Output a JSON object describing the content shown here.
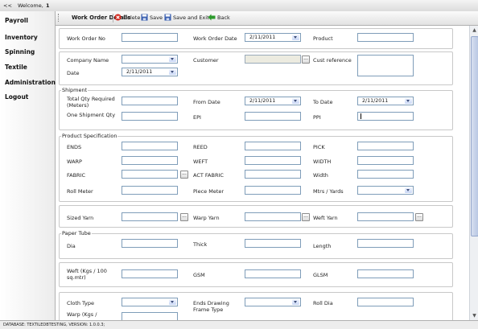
{
  "topbar": {
    "nav": "<<",
    "welcome": "Welcome,",
    "user": "1"
  },
  "sidebar": {
    "items": [
      {
        "label": "Payroll"
      },
      {
        "label": "Inventory"
      },
      {
        "label": "Spinning"
      },
      {
        "label": "Textile"
      },
      {
        "label": "Administration"
      },
      {
        "label": "Logout"
      }
    ]
  },
  "toolbar": {
    "title": "Work Order Details",
    "delete_label": "Delete",
    "save_label": "Save",
    "save_exit_label": "Save and Exit",
    "back_label": "Back",
    "icons": {
      "delete": "delete-icon",
      "save": "save-icon",
      "save_exit": "save-exit-icon",
      "back": "back-arrow-icon"
    },
    "colors": {
      "delete": "#d2281e",
      "save": "#3a5fb0",
      "back": "#2c9a2c"
    }
  },
  "form": {
    "work_order_no_label": "Work Order No",
    "work_order_date_label": "Work Order Date",
    "work_order_date_value": "2/11/2011",
    "product_label": "Product",
    "company_name_label": "Company Name",
    "customer_label": "Customer",
    "cust_reference_label": "Cust reference",
    "date_label": "Date",
    "date_value": "2/11/2011",
    "shipment_title": "Shipment",
    "total_qty_label": "Total Qty Required (Meters)",
    "from_date_label": "From Date",
    "from_date_value": "2/11/2011",
    "to_date_label": "To Date",
    "to_date_value": "2/11/2011",
    "one_shipment_qty_label": "One Shipment Qty",
    "epi_label": "EPI",
    "ppi_label": "PPI",
    "product_spec_title": "Product Specification",
    "ends_label": "ENDS",
    "reed_label": "REED",
    "pick_label": "PICK",
    "warp_label": "WARP",
    "weft_label": "WEFT",
    "width_caps_label": "WIDTH",
    "fabric_label": "FABRIC",
    "act_fabric_label": "ACT FABRIC",
    "width_label": "Width",
    "roll_meter_label": "Roll Meter",
    "piece_meter_label": "Piece Meter",
    "mtrs_yards_label": "Mtrs / Yards",
    "sized_yarn_label": "Sized Yarn",
    "warp_yarn_label": "Warp Yarn",
    "weft_yarn_label": "Weft Yarn",
    "paper_tube_title": "Paper Tube",
    "dia_label": "Dia",
    "thick_label": "Thick",
    "length_label": "Length",
    "weft_kgs_label": "Weft (Kgs / 100 sq.mtr)",
    "gsm_label": "GSM",
    "glsm_label": "GLSM",
    "cloth_type_label": "Cloth Type",
    "ends_drawing_label": "Ends Drawing Frame Type",
    "roll_dia_label": "Roll Dia",
    "warp_kgs_label": "Warp (Kgs /",
    "browse_label": "..."
  },
  "status": {
    "text": "DATABASE: TEXTILEDBTESTING,   VERSION: 1.0.0.3;"
  }
}
